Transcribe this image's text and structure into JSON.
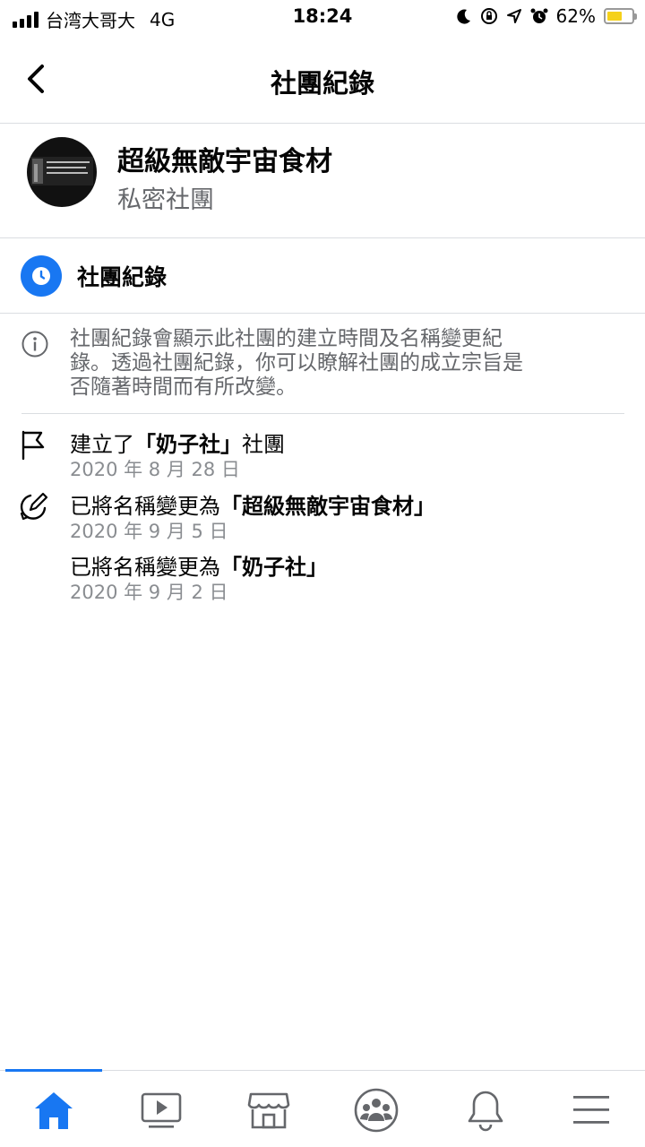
{
  "status_bar": {
    "carrier": "台湾大哥大",
    "network": "4G",
    "time": "18:24",
    "battery": "62%"
  },
  "header": {
    "title": "社團紀錄",
    "back_icon": "chevron-left-icon"
  },
  "group": {
    "name": "超級無敵宇宙食材",
    "privacy": "私密社團"
  },
  "section": {
    "title": "社團紀錄",
    "icon": "clock-icon"
  },
  "info": {
    "icon": "info-icon",
    "lines": [
      "社團紀錄會顯示此社團的建立時間及名稱變更紀",
      "錄。透過社團紀錄，你可以瞭解社團的成立宗旨是",
      "否隨著時間而有所改變。"
    ]
  },
  "events": [
    {
      "icon": "flag-icon",
      "prefix": "建立了",
      "highlight": "「奶子社」",
      "suffix": "社團",
      "date": "2020 年 8 月 28 日"
    },
    {
      "icon": "edit-pencil-icon",
      "prefix": "已將名稱變更為",
      "highlight": "「超級無敵宇宙食材」",
      "suffix": "",
      "date": "2020 年 9 月 5 日"
    },
    {
      "icon": "",
      "prefix": "已將名稱變更為",
      "highlight": "「奶子社」",
      "suffix": "",
      "date": "2020 年 9 月 2 日"
    }
  ],
  "tabbar": {
    "active": "home",
    "tabs": [
      "home-icon",
      "video-icon",
      "marketplace-icon",
      "groups-icon",
      "notifications-icon",
      "menu-icon"
    ]
  },
  "colors": {
    "accent": "#1877f2",
    "secondary_text": "#65676b",
    "divider": "#dadde1"
  }
}
